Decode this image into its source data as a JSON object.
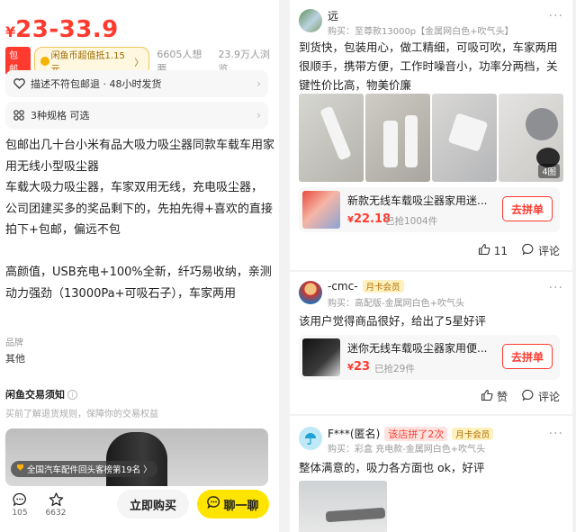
{
  "listing": {
    "price_currency": "¥",
    "price": "23-33.9",
    "badge_post": "包邮",
    "badge_coin": "闲鱼币超值抵1.15元",
    "badge_coin_chev": "〉",
    "want_count": "6605人想要",
    "view_count": "23.9万人浏览",
    "service_row": "描述不符包邮退 · 48小时发货",
    "spec_row": "3种规格 可选",
    "chevron": "›",
    "desc_lines": [
      "包邮出几十台小米有品大吸力吸尘器同款车载车用家用无线小型吸尘器",
      "车载大吸力吸尘器，车家双用无线，充电吸尘器，",
      "公司团建买多的奖品剩下的，先拍先得+喜欢的直接拍下+包邮，偏远不包",
      "",
      "高颜值，USB充电+100%全新，纤巧易收纳，亲测动力强劲（13000Pa+可吸石子），车家两用"
    ],
    "brand_label": "品牌",
    "brand_value": "其他",
    "notice_title": "闲鱼交易须知",
    "notice_info": "i",
    "notice_sub": "买前了解退货规则，保障你的交易权益",
    "rank_badge": "全国汽车配件回头客榜第19名",
    "rank_chev": "〉",
    "comment_count": "105",
    "fav_count": "6632",
    "buy_label": "立即购买",
    "chat_label": "聊一聊"
  },
  "reviews": [
    {
      "user": "远",
      "purchase": "购买：至尊款13000p【金属网白色+吹气头】",
      "more": "···",
      "text": "到货快，包装用心，做工精细，可吸可吹，车家两用很顺手，携带方便，工作时噪音小，功率分两档，关键性价比高，物美价廉",
      "pic_count": "4图",
      "product": {
        "title": "新款无线车载吸尘器家用迷...",
        "currency": "¥",
        "price": "22.18",
        "sold": "已抢1004件",
        "button": "去拼单"
      },
      "like_count": "11",
      "comment_label": "评论"
    },
    {
      "user": "-cmc-",
      "member_tag": "月卡会员",
      "purchase": "购买：高配版-金属网白色+吹气头",
      "more": "···",
      "text": "该用户觉得商品很好，给出了5星好评",
      "product": {
        "title": "迷你无线车载吸尘器家用便...",
        "currency": "¥",
        "price": "23",
        "sold": "已抢29件",
        "button": "去拼单"
      },
      "like_label": "赞",
      "comment_label": "评论"
    },
    {
      "user": "F***(匿名)",
      "group_tag": "该店拼了2次",
      "member_tag": "月卡会员",
      "purchase": "购买：彩盒 充电款-金属网白色+吹气头",
      "more": "···",
      "text": "整体满意的，吸力各方面也 ok，好评"
    }
  ],
  "colors": {
    "price_red": "#ff3b30",
    "chat_yellow": "#ffe400",
    "member_gold": "#b06d00"
  },
  "icons": [
    "heart-outline-icon",
    "grid-icon",
    "chevron-right-icon",
    "info-icon",
    "trophy-icon",
    "comment-icon",
    "star-outline-icon",
    "chat-bubble-icon",
    "thumbs-up-icon",
    "comment-small-icon",
    "more-icon"
  ]
}
